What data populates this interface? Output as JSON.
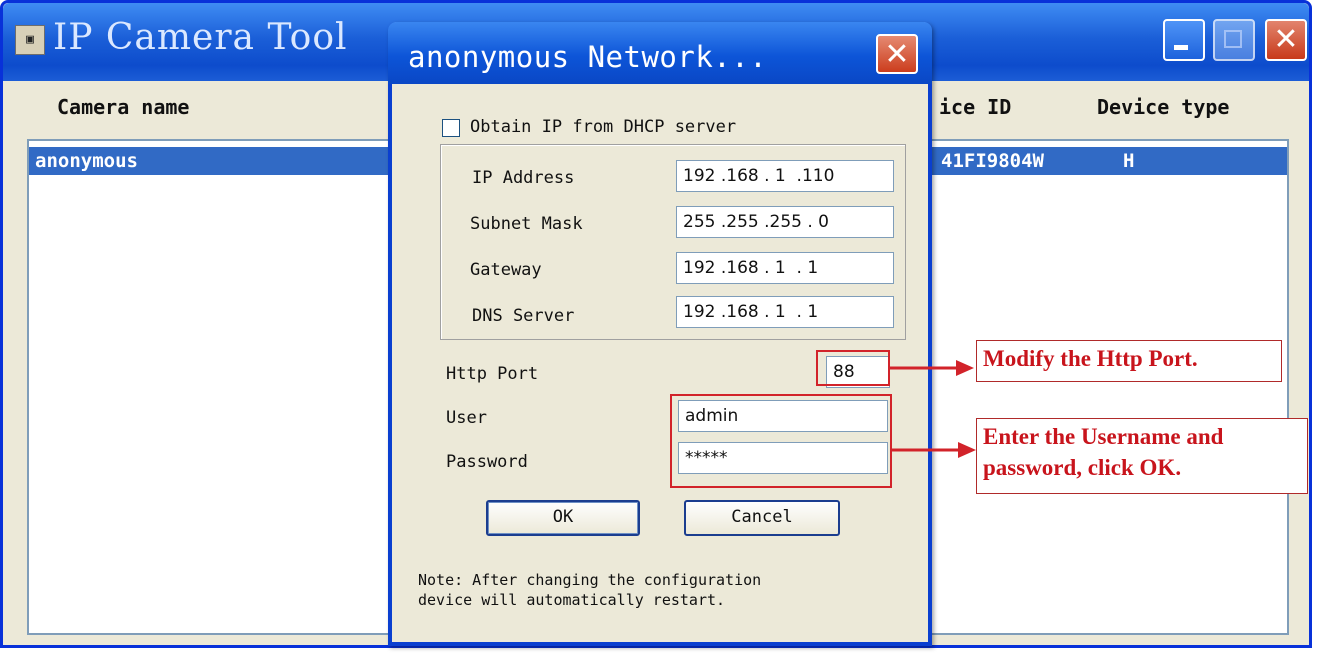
{
  "main_window": {
    "title": "IP Camera Tool",
    "app_icon": "camera-tool-icon",
    "columns": [
      "Camera name",
      "ice ID",
      "Device type"
    ],
    "rows": [
      {
        "name": "anonymous",
        "device_id": "41FI9804W",
        "device_type": "H"
      }
    ]
  },
  "dialog": {
    "title": "anonymous Network...",
    "dhcp_label": "Obtain IP from DHCP server",
    "dhcp_checked": false,
    "fields": {
      "ip_label": "IP Address",
      "ip_value": "192 .168 . 1  .110",
      "subnet_label": "Subnet Mask",
      "subnet_value": "255 .255 .255 . 0",
      "gateway_label": "Gateway",
      "gateway_value": "192 .168 . 1  . 1",
      "dns_label": "DNS Server",
      "dns_value": "192 .168 . 1  . 1",
      "port_label": "Http Port",
      "port_value": "88",
      "user_label": "User",
      "user_value": "admin",
      "password_label": "Password",
      "password_value": "*****"
    },
    "ok_label": "OK",
    "cancel_label": "Cancel",
    "note_line1": "Note: After changing the configuration",
    "note_line2": "device will automatically restart."
  },
  "annotations": {
    "port_callout": "Modify the Http Port.",
    "credentials_callout_line1": "Enter the Username and",
    "credentials_callout_line2": "password, click OK.",
    "color": "#d2232a"
  }
}
